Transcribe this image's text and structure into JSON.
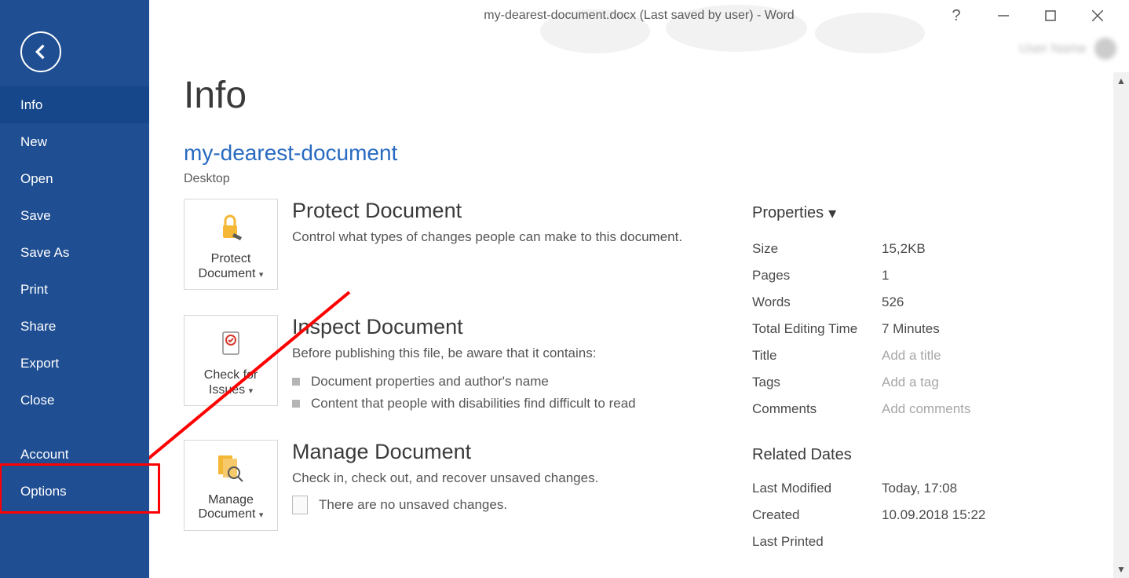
{
  "window_title": "my-dearest-document.docx (Last saved by user) - Word",
  "sidebar": {
    "items": [
      {
        "label": "Info",
        "selected": true
      },
      {
        "label": "New"
      },
      {
        "label": "Open"
      },
      {
        "label": "Save"
      },
      {
        "label": "Save As"
      },
      {
        "label": "Print"
      },
      {
        "label": "Share"
      },
      {
        "label": "Export"
      },
      {
        "label": "Close"
      }
    ],
    "footer": [
      {
        "label": "Account"
      },
      {
        "label": "Options"
      }
    ]
  },
  "page": {
    "heading": "Info",
    "doc_name": "my-dearest-document",
    "doc_location": "Desktop",
    "sections": {
      "protect": {
        "tile": "Protect Document",
        "title": "Protect Document",
        "desc": "Control what types of changes people can make to this document."
      },
      "inspect": {
        "tile": "Check for Issues",
        "title": "Inspect Document",
        "desc": "Before publishing this file, be aware that it contains:",
        "bullets": [
          "Document properties and author's name",
          "Content that people with disabilities find difficult to read"
        ]
      },
      "manage": {
        "tile": "Manage Document",
        "title": "Manage Document",
        "desc": "Check in, check out, and recover unsaved changes.",
        "nochange": "There are no unsaved changes."
      }
    },
    "properties": {
      "heading": "Properties",
      "rows": [
        [
          "Size",
          "15,2KB"
        ],
        [
          "Pages",
          "1"
        ],
        [
          "Words",
          "526"
        ],
        [
          "Total Editing Time",
          "7 Minutes"
        ],
        [
          "Title",
          "Add a title"
        ],
        [
          "Tags",
          "Add a tag"
        ],
        [
          "Comments",
          "Add comments"
        ]
      ],
      "ghost_indexes": [
        4,
        5,
        6
      ]
    },
    "related_dates": {
      "heading": "Related Dates",
      "rows": [
        [
          "Last Modified",
          "Today, 17:08"
        ],
        [
          "Created",
          "10.09.2018 15:22"
        ],
        [
          "Last Printed",
          ""
        ]
      ]
    }
  }
}
